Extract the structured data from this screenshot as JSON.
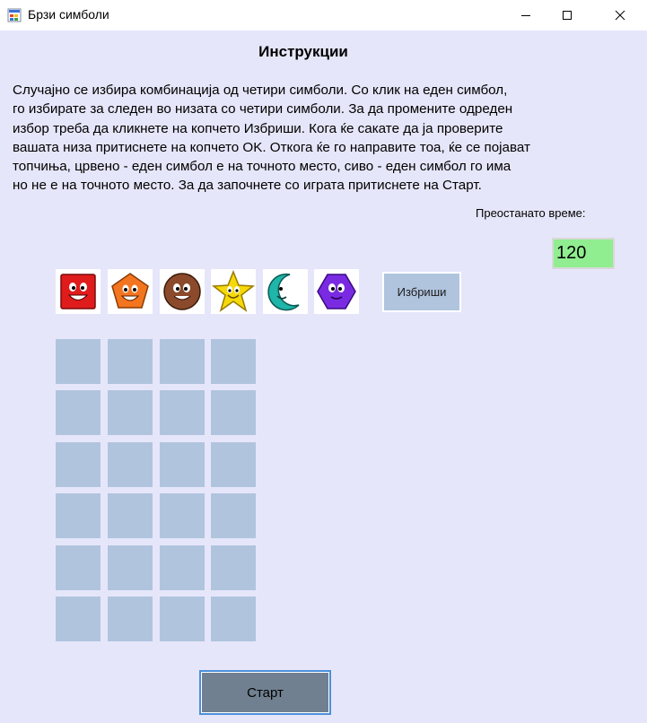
{
  "window": {
    "title": "Брзи симболи"
  },
  "instructions": {
    "title": "Инструкции",
    "lines": [
      "Случајно се избира комбинација од четири симболи. Со клик на еден симбол,",
      "го избирате за следен во низата со четири симболи. За да промените одреден",
      "избор треба да кликнете на копчето Избриши. Кога ќе сакате да ја проверите",
      "вашата низа притиснете на копчето OK. Откога ќе го направите тоа, ќе се појават",
      "топчиња, црвено - еден симбол е на точното место, сиво - еден симбол го има",
      "но не е на точното место. За да започнете со играта притиснете на Старт."
    ]
  },
  "timer": {
    "label": "Преостанато време:",
    "value": "120",
    "background": "#90ee90"
  },
  "symbols": [
    {
      "name": "red-square-face",
      "color": "#e01b1b"
    },
    {
      "name": "orange-pentagon-face",
      "color": "#f4751f"
    },
    {
      "name": "brown-circle-face",
      "color": "#8b4a2b"
    },
    {
      "name": "yellow-star-face",
      "color": "#f5d90a"
    },
    {
      "name": "teal-moon-face",
      "color": "#1fb5a8"
    },
    {
      "name": "purple-hexagon-face",
      "color": "#7a2be2"
    }
  ],
  "buttons": {
    "delete": "Избриши",
    "start": "Старт"
  },
  "board": {
    "rows": 6,
    "cols": 4,
    "cell_color": "#b0c4de"
  },
  "colors": {
    "background": "#e6e6fa",
    "start_button": "#708090"
  }
}
